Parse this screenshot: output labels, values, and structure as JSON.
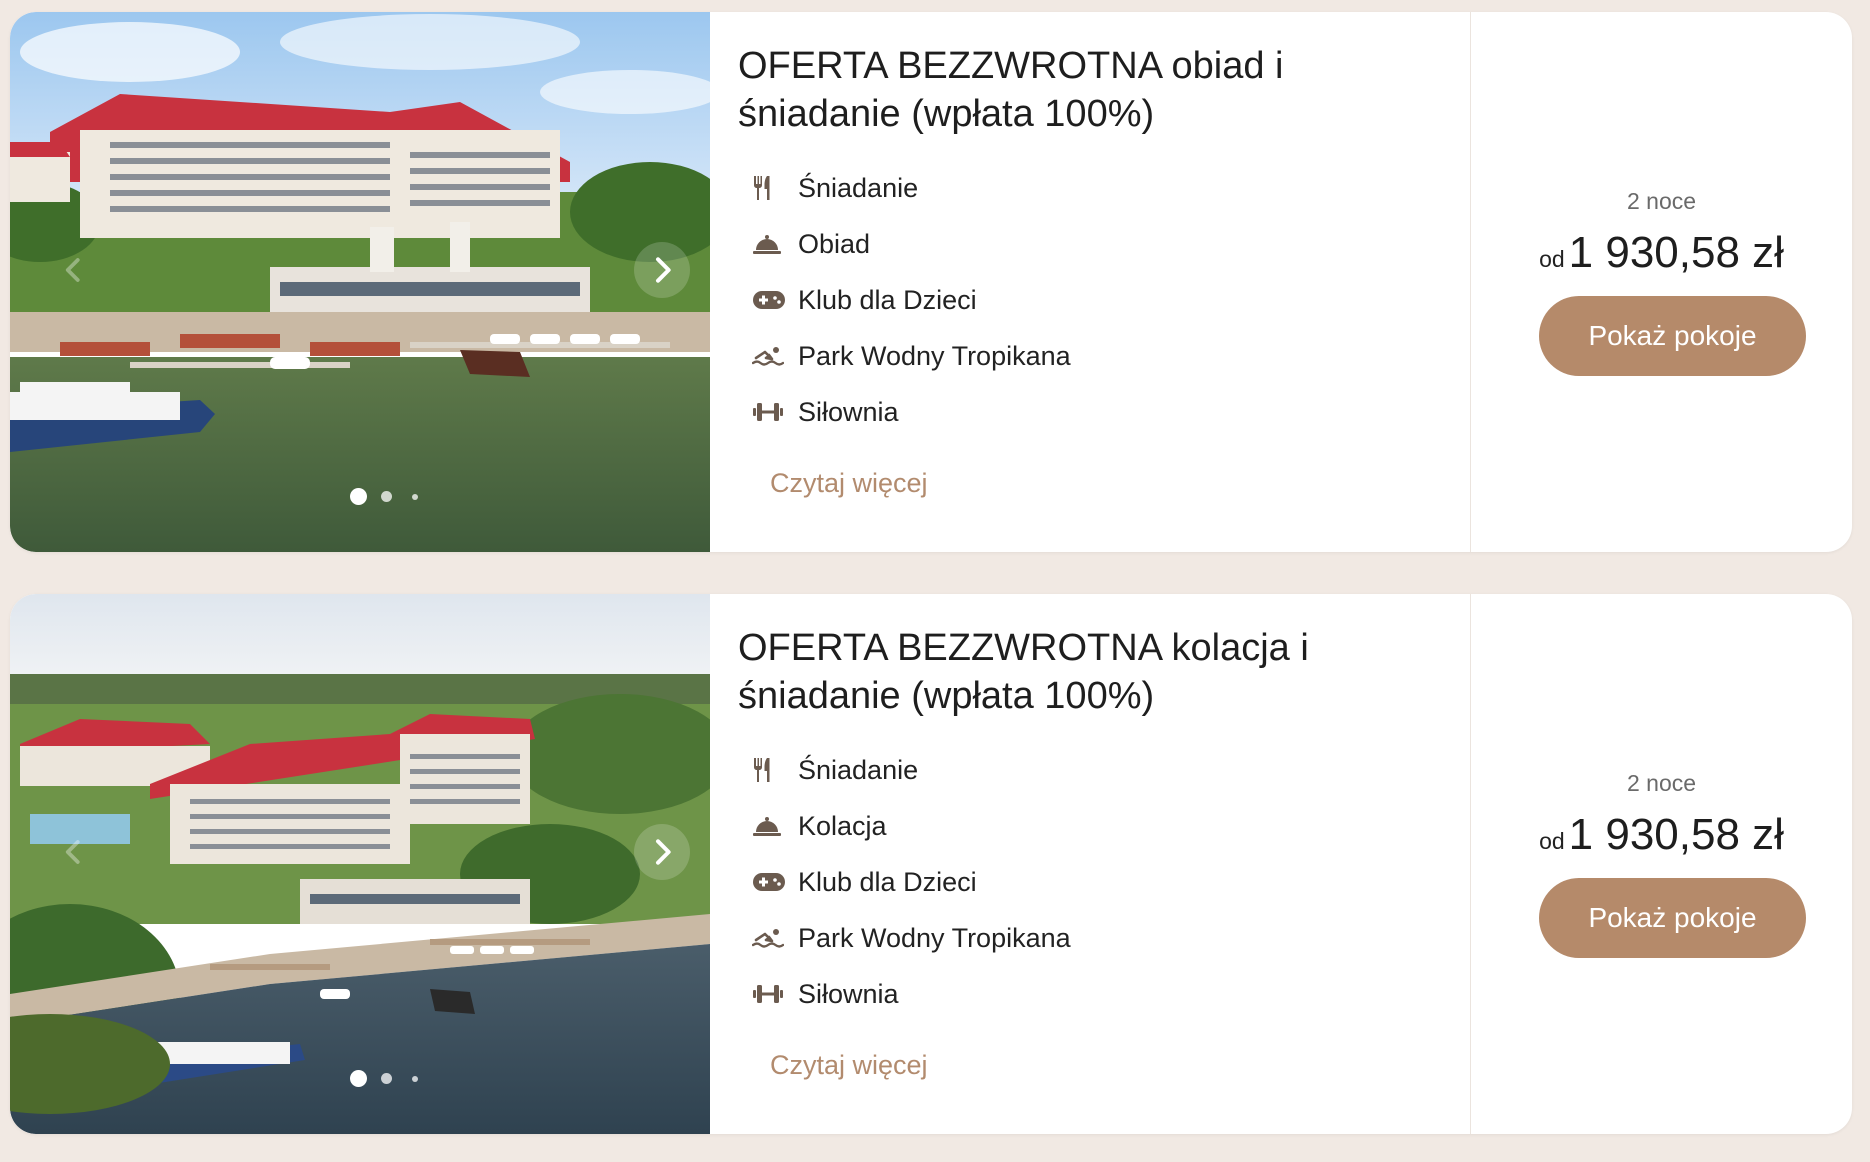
{
  "offers": [
    {
      "title": "OFERTA BEZZWROTNA obiad i śniadanie (wpłata 100%)",
      "amenities": [
        {
          "icon": "cutlery-icon",
          "label": "Śniadanie"
        },
        {
          "icon": "cloche-icon",
          "label": "Obiad"
        },
        {
          "icon": "gamepad-icon",
          "label": "Klub dla Dzieci"
        },
        {
          "icon": "swimmer-icon",
          "label": "Park Wodny Tropikana"
        },
        {
          "icon": "dumbbell-icon",
          "label": "Siłownia"
        }
      ],
      "read_more": "Czytaj więcej",
      "nights": "2 noce",
      "price_prefix": "od",
      "price": "1 930,58 zł",
      "cta": "Pokaż pokoje",
      "carousel": {
        "slides": 3,
        "active": 1
      }
    },
    {
      "title": "OFERTA BEZZWROTNA kolacja i śniadanie (wpłata 100%)",
      "amenities": [
        {
          "icon": "cutlery-icon",
          "label": "Śniadanie"
        },
        {
          "icon": "cloche-icon",
          "label": "Kolacja"
        },
        {
          "icon": "gamepad-icon",
          "label": "Klub dla Dzieci"
        },
        {
          "icon": "swimmer-icon",
          "label": "Park Wodny Tropikana"
        },
        {
          "icon": "dumbbell-icon",
          "label": "Siłownia"
        }
      ],
      "read_more": "Czytaj więcej",
      "nights": "2 noce",
      "price_prefix": "od",
      "price": "1 930,58 zł",
      "cta": "Pokaż pokoje",
      "carousel": {
        "slides": 3,
        "active": 1
      }
    }
  ],
  "colors": {
    "page_background": "#f1e9e3",
    "card_background": "#ffffff",
    "accent": "#b58a6a",
    "link": "#b28b6e",
    "icon": "#6b5b4f"
  }
}
